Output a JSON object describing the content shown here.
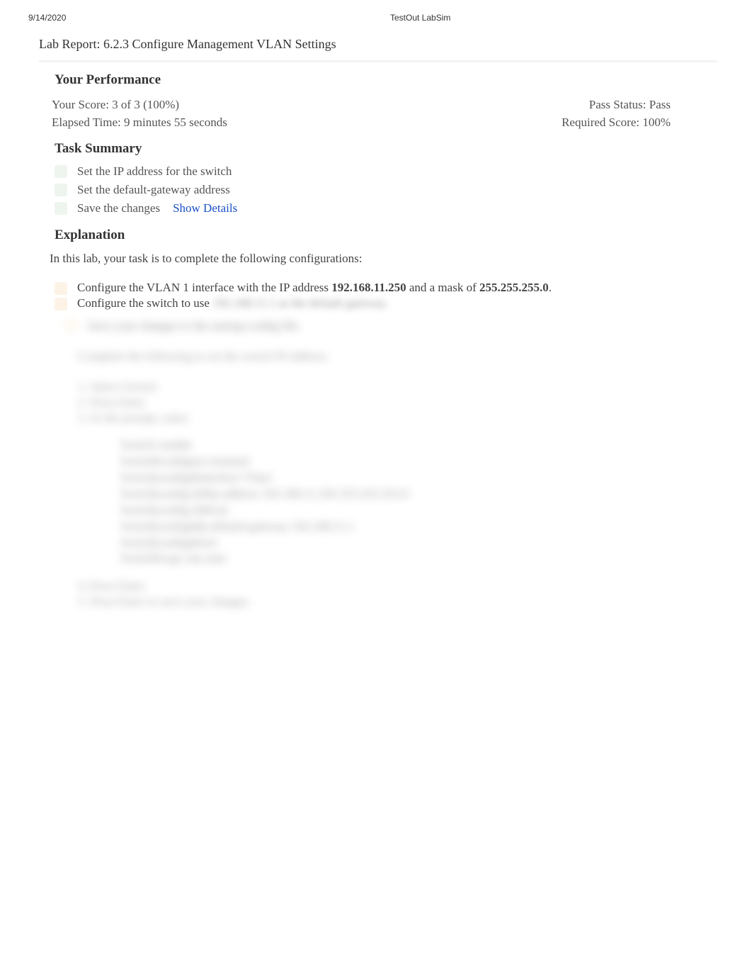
{
  "header": {
    "date": "9/14/2020",
    "app_title": "TestOut LabSim"
  },
  "report": {
    "title": "Lab Report: 6.2.3 Configure Management VLAN Settings"
  },
  "performance": {
    "heading": "Your Performance",
    "score_label": "Your Score: 3 of 3 (100%)",
    "elapsed_label": "Elapsed Time: 9 minutes 55 seconds",
    "pass_status": "Pass Status: Pass",
    "required_score": "Required Score: 100%"
  },
  "task_summary": {
    "heading": "Task Summary",
    "items": [
      {
        "label": "Set the IP address for the switch"
      },
      {
        "label": "Set the default-gateway address"
      },
      {
        "label": "Save the changes",
        "details_link": "Show Details"
      }
    ]
  },
  "explanation": {
    "heading": "Explanation",
    "intro": "In this lab, your task is to complete the following configurations:",
    "config_items": [
      {
        "text_prefix": "Configure the VLAN 1 interface with the IP address ",
        "bold1": "192.168.11.250",
        "text_mid": " and a mask of ",
        "bold2": "255.255.255.0",
        "text_suffix": "."
      },
      {
        "text_prefix": "Configure the switch to use ",
        "blurred_tail": "192.168.11.1 as the default gateway."
      }
    ],
    "blurred_config_item": "Save your changes to the startup-config file.",
    "blurred_intro": "Complete the following to set the switch IP address:",
    "blurred_numbered": [
      "1. Select Switch.",
      "2. Press Enter.",
      "3. At the prompt, enter:"
    ],
    "blurred_code": [
      "Switch>enable",
      "Switch#configure terminal",
      "Switch(config)#interface Vlan1",
      "Switch(config-if)#ip address 192.168.11.250 255.255.255.0",
      "Switch(config-if)#exit",
      "Switch(config)#ip default-gateway 192.168.11.1",
      "Switch(config)#exit",
      "Switch#copy run start"
    ],
    "blurred_bottom": [
      "4. Press Enter.",
      "5. Press Enter to save your changes."
    ]
  }
}
